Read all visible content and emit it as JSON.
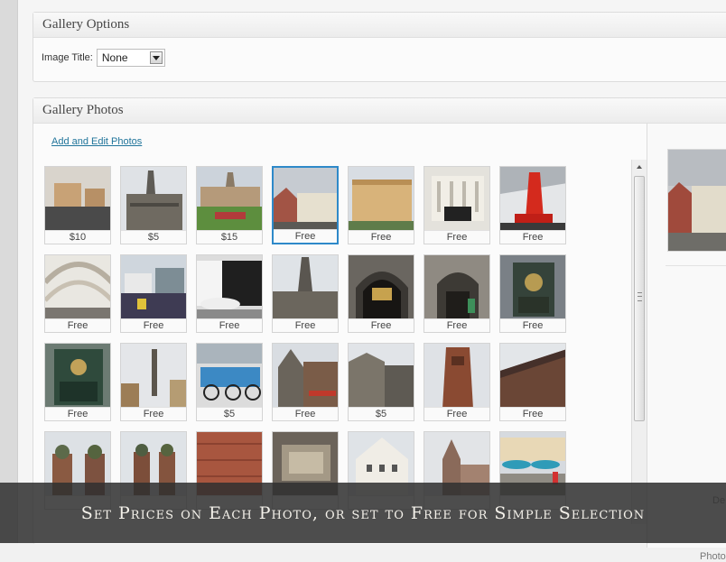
{
  "gallery_options": {
    "title": "Gallery Options",
    "image_title_label": "Image Title:",
    "image_title_value": "None"
  },
  "gallery_photos": {
    "title": "Gallery Photos",
    "add_edit_link": "Add and Edit Photos",
    "photos": [
      {
        "price": "$10",
        "scene": "interior-chairs"
      },
      {
        "price": "$5",
        "scene": "gothic-town-hall"
      },
      {
        "price": "$15",
        "scene": "palace-garden"
      },
      {
        "price": "Free",
        "scene": "baroque-street",
        "selected": true
      },
      {
        "price": "Free",
        "scene": "yellow-building"
      },
      {
        "price": "Free",
        "scene": "columned-hall"
      },
      {
        "price": "Free",
        "scene": "red-sculpture"
      },
      {
        "price": "Free",
        "scene": "glass-canopy"
      },
      {
        "price": "Free",
        "scene": "plaza-stalls"
      },
      {
        "price": "Free",
        "scene": "car-showroom"
      },
      {
        "price": "Free",
        "scene": "town-hall-tower"
      },
      {
        "price": "Free",
        "scene": "glockenspiel-arch"
      },
      {
        "price": "Free",
        "scene": "ornate-doorway"
      },
      {
        "price": "Free",
        "scene": "clock-figures"
      },
      {
        "price": "Free",
        "scene": "green-glockenspiel"
      },
      {
        "price": "Free",
        "scene": "marian-column"
      },
      {
        "price": "$5",
        "scene": "bike-rack"
      },
      {
        "price": "Free",
        "scene": "gothic-facade"
      },
      {
        "price": "$5",
        "scene": "old-buildings"
      },
      {
        "price": "Free",
        "scene": "brick-tower"
      },
      {
        "price": "Free",
        "scene": "dark-roof"
      },
      {
        "price": "",
        "scene": "frauenkirche"
      },
      {
        "price": "",
        "scene": "twin-towers"
      },
      {
        "price": "",
        "scene": "brick-wall"
      },
      {
        "price": "",
        "scene": "stone-relief"
      },
      {
        "price": "",
        "scene": "white-gable"
      },
      {
        "price": "",
        "scene": "church-spire"
      },
      {
        "price": "",
        "scene": "cafe-umbrellas"
      }
    ]
  },
  "detail_panel": {
    "label_description": "De",
    "label_photo": "Photo"
  },
  "banner": {
    "text": "Set Prices on Each Photo, or set to Free for Simple Selection"
  },
  "colors": {
    "link": "#21759b",
    "selected_border": "#2e89c9",
    "banner_bg": "#303030"
  }
}
